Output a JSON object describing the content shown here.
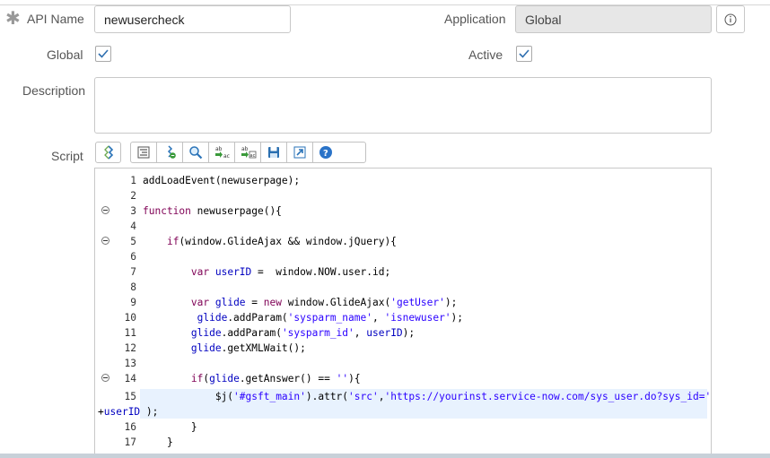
{
  "form": {
    "api_name_label": "API Name",
    "api_name_value": "newusercheck",
    "application_label": "Application",
    "application_value": "Global",
    "global_label": "Global",
    "global_checked": true,
    "active_label": "Active",
    "active_checked": true,
    "description_label": "Description",
    "description_value": "",
    "script_label": "Script"
  },
  "toolbar": {
    "icons": [
      "toggle-syntax-icon",
      "format-code-icon",
      "comment-toggle-icon",
      "search-icon",
      "replace-icon",
      "replace-all-icon",
      "save-icon",
      "fullscreen-icon",
      "help-icon"
    ]
  },
  "editor": {
    "lines": [
      {
        "n": "1",
        "code": "addLoadEvent(newuserpage);"
      },
      {
        "n": "2",
        "code": ""
      },
      {
        "n": "3",
        "code": "function newuserpage(){"
      },
      {
        "n": "4",
        "code": ""
      },
      {
        "n": "5",
        "code": "    if(window.GlideAjax && window.jQuery){"
      },
      {
        "n": "6",
        "code": ""
      },
      {
        "n": "7",
        "code": "        var userID =  window.NOW.user.id;"
      },
      {
        "n": "8",
        "code": ""
      },
      {
        "n": "9",
        "code": "        var glide = new window.GlideAjax('getUser');"
      },
      {
        "n": "10",
        "code": "         glide.addParam('sysparm_name', 'isnewuser');"
      },
      {
        "n": "11",
        "code": "        glide.addParam('sysparm_id', userID);"
      },
      {
        "n": "12",
        "code": "        glide.getXMLWait();"
      },
      {
        "n": "13",
        "code": ""
      },
      {
        "n": "14",
        "code": "        if(glide.getAnswer() == ''){"
      },
      {
        "n": "15",
        "code": "            $j('#gsft_main').attr('src','https://yourinst.service-now.com/sys_user.do?sys_id='"
      },
      {
        "n": "",
        "code": "+userID );"
      },
      {
        "n": "16",
        "code": "        }"
      },
      {
        "n": "17",
        "code": "    }"
      }
    ],
    "fold_lines": [
      "3",
      "5",
      "14"
    ],
    "highlight_line": "15"
  }
}
